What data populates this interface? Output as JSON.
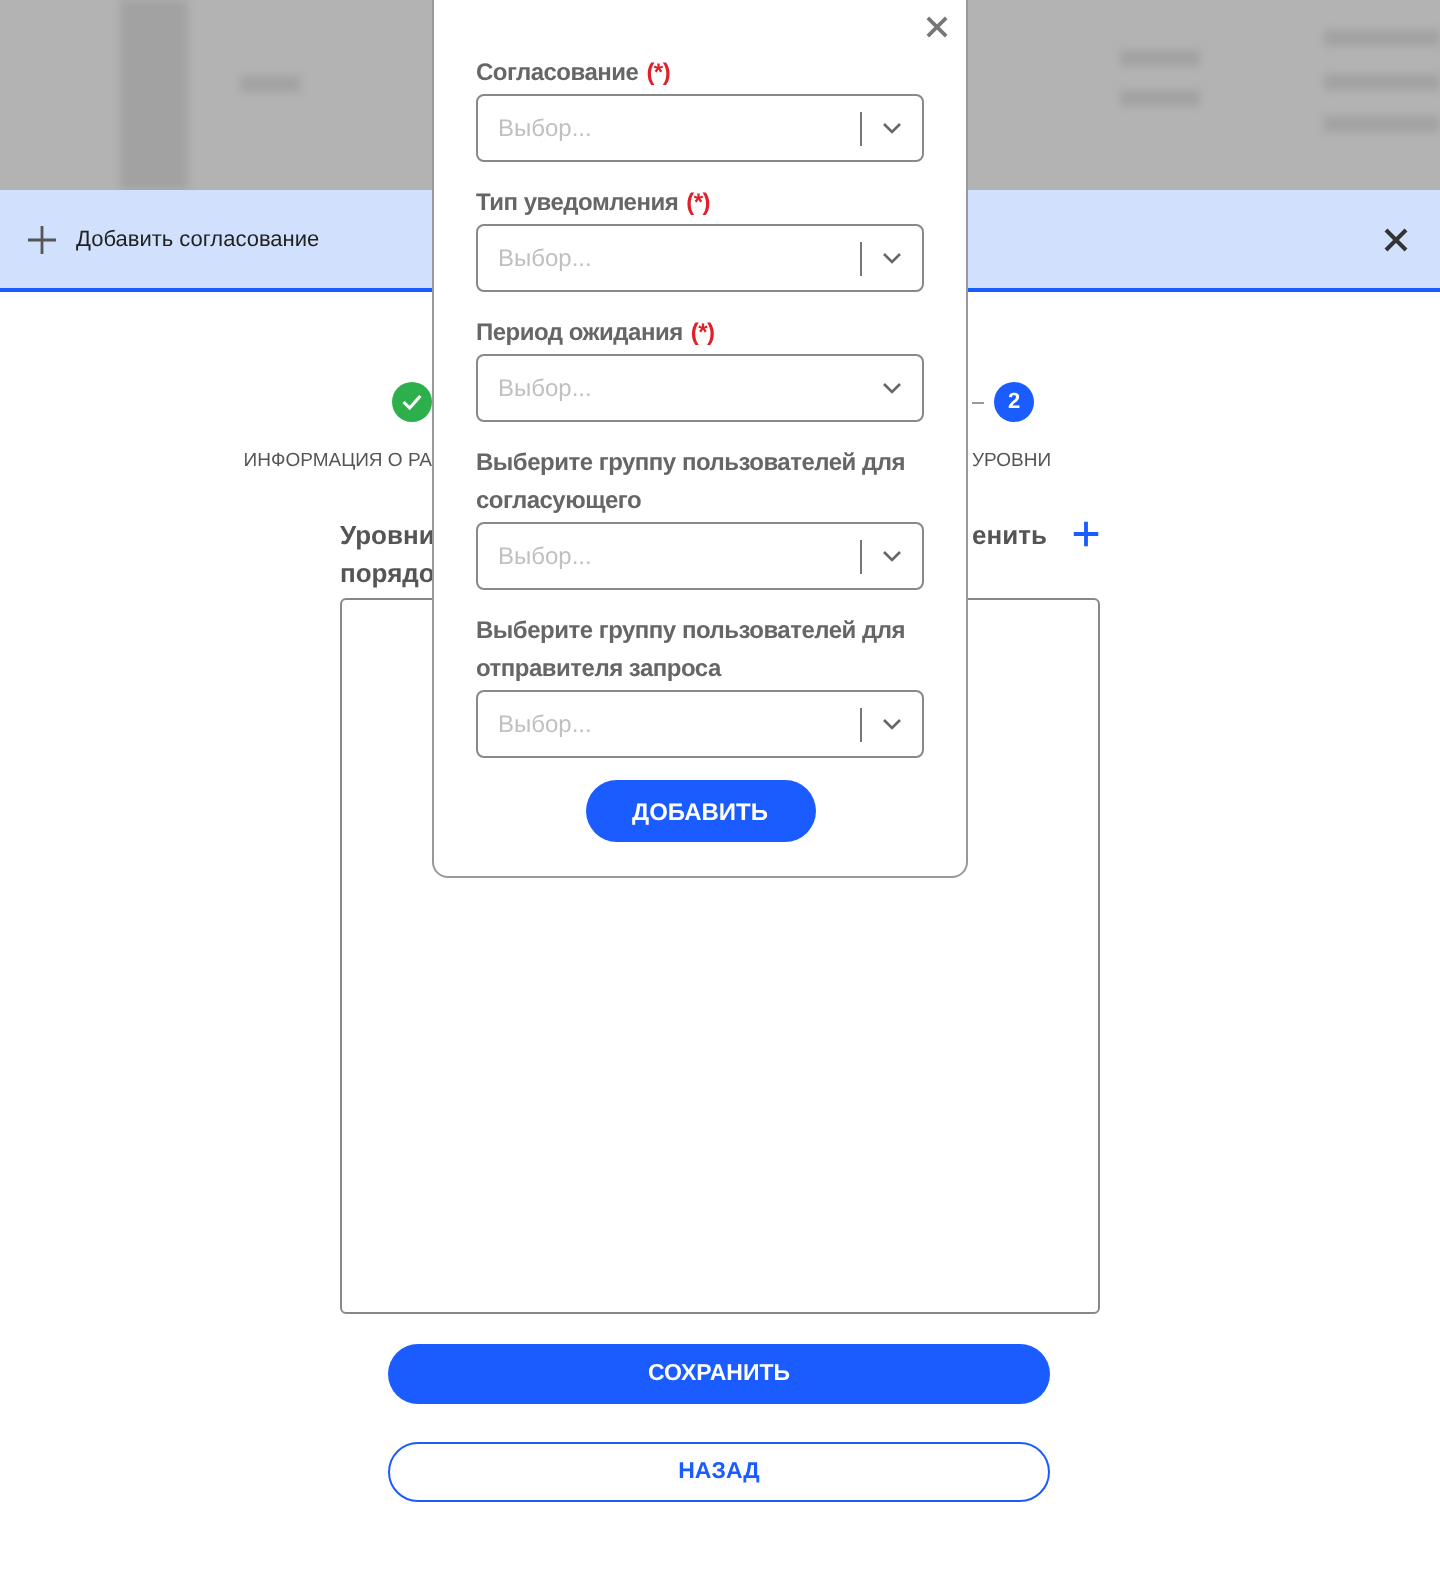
{
  "toolbar": {
    "title": "Добавить согласование"
  },
  "stepper": {
    "steps": [
      {
        "done": true,
        "label": "ИНФОРМАЦИЯ О РА"
      },
      {
        "done": false,
        "number": "2",
        "label": "УРОВНИ"
      }
    ]
  },
  "levels_panel": {
    "title_left_lines": [
      "Уровни",
      "порядо"
    ],
    "title_right": "енить"
  },
  "buttons": [
    {
      "kind": "primary",
      "label": "СОХРАНИТЬ"
    },
    {
      "kind": "outline",
      "label": "НАЗАД"
    }
  ],
  "modal": {
    "fields": [
      {
        "label": "Согласование",
        "required_mark": "(*)",
        "placeholder": "Выбор...",
        "separator": true
      },
      {
        "label": "Тип уведомления",
        "required_mark": "(*)",
        "placeholder": "Выбор...",
        "separator": true
      },
      {
        "label": "Период ожидания",
        "required_mark": "(*)",
        "placeholder": "Выбор...",
        "separator": false
      },
      {
        "label": "Выберите группу пользователей для согласующего",
        "placeholder": "Выбор...",
        "separator": true
      },
      {
        "label": "Выберите группу пользователей для отправителя запроса",
        "placeholder": "Выбор...",
        "separator": true
      }
    ],
    "submit": "ДОБАВИТЬ"
  }
}
